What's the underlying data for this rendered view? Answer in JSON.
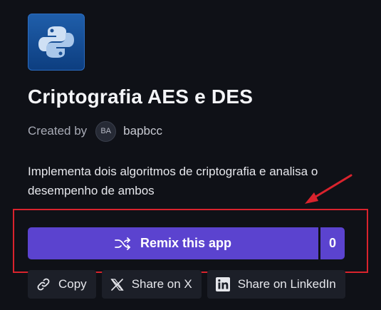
{
  "app": {
    "title": "Criptografia AES e DES",
    "created_by_label": "Created by",
    "creator_initials": "BA",
    "creator_name": "bapbcc",
    "description": "Implementa dois algoritmos de criptografia e analisa o desempenho de ambos",
    "icon": "python-logo-icon"
  },
  "remix": {
    "label": "Remix this app",
    "count": "0",
    "icon": "shuffle-icon"
  },
  "share": {
    "copy_label": "Copy",
    "x_label": "Share on X",
    "linkedin_label": "Share on LinkedIn"
  },
  "colors": {
    "background": "#0f1117",
    "accent": "#5b43cf",
    "annotation": "#d9232d"
  }
}
